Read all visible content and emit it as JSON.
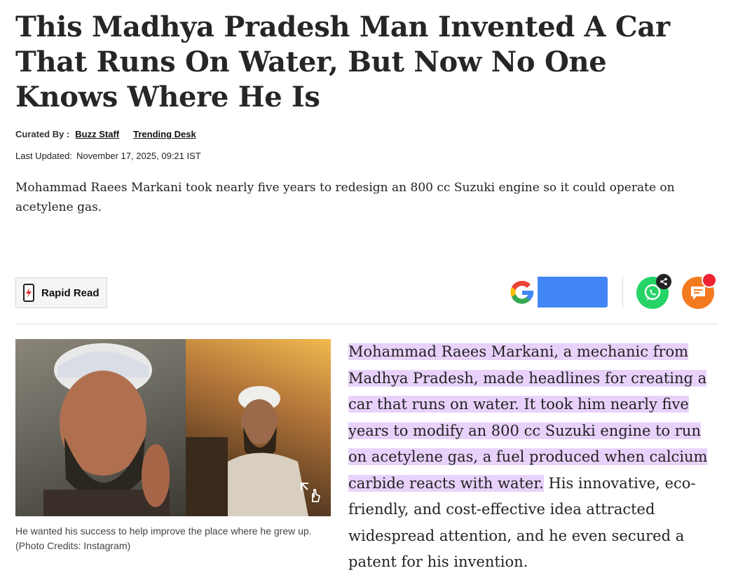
{
  "article": {
    "headline": "This Madhya Pradesh Man Invented A Car That Runs On Water, But Now No One Knows Where He Is",
    "curated_label": "Curated By :",
    "authors": [
      "Buzz Staff",
      "Trending Desk"
    ],
    "updated_label": "Last Updated:",
    "updated_value": "November 17, 2025, 09:21 IST",
    "summary": "Mohammad Raees Markani took nearly five years to redesign an 800 cc Suzuki engine so it could operate on acetylene gas."
  },
  "toolbar": {
    "rapid_read_label": "Rapid Read",
    "icons": [
      "phone-bolt-icon",
      "google-icon",
      "whatsapp-icon",
      "share-icon",
      "comment-icon"
    ],
    "colors": {
      "google_blue": "#4285f4",
      "whatsapp": "#25d366",
      "comment": "#f47a20",
      "notification": "#ee2233"
    }
  },
  "media": {
    "caption": "He wanted his success to help improve the place where he grew up. (Photo Credits: Instagram)",
    "icons": [
      "expand-icon"
    ]
  },
  "body": {
    "highlighted": "Mohammad Raees Markani, a mechanic from Madhya Pradesh, made headlines for creating a car that runs on water. It took him nearly five years to modify an 800 cc Suzuki engine to run on acetylene gas, a fuel produced when calcium carbide reacts with water.",
    "rest": " His innovative, eco-friendly, and cost-effective idea attracted widespread attention, and he even secured a patent for his invention.",
    "highlight_color": "#e8d2fb"
  }
}
